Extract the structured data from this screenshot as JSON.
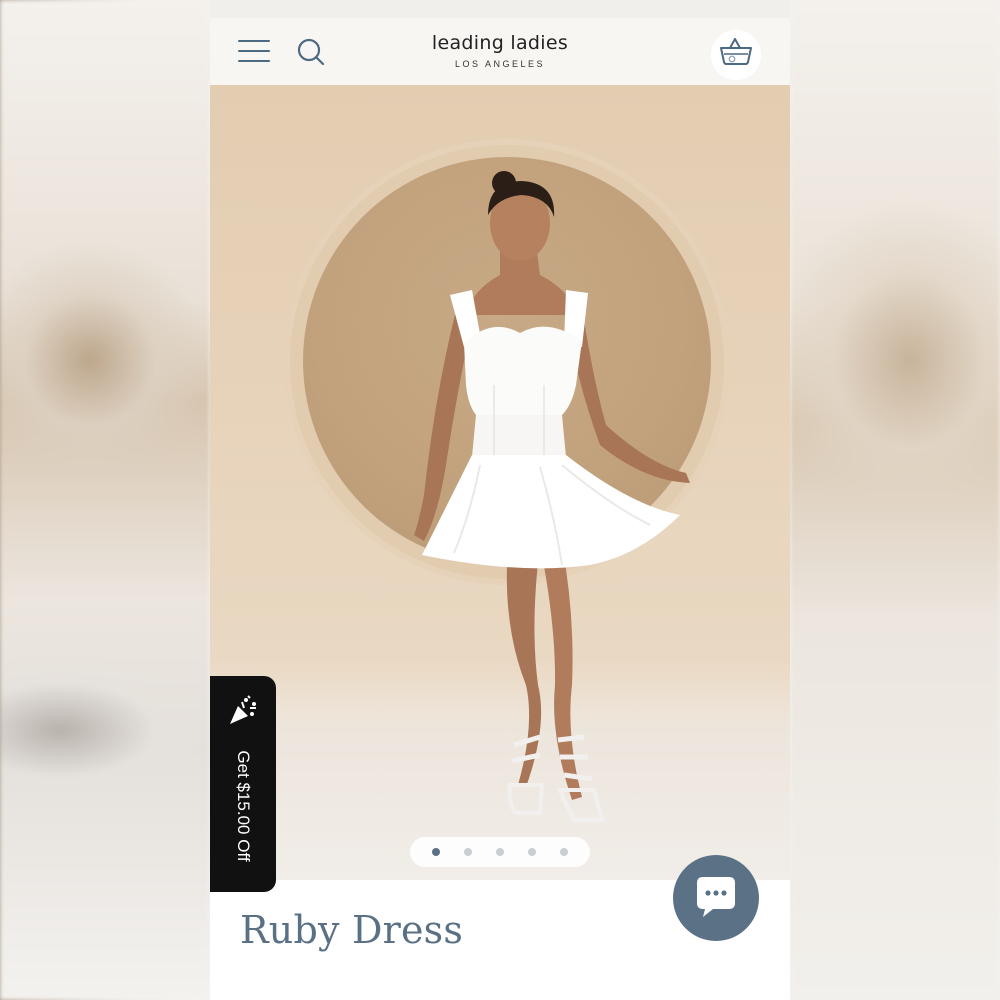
{
  "brand": {
    "name": "leading ladies",
    "subtitle": "LOS ANGELES"
  },
  "header": {
    "menu_icon": "hamburger-menu-icon",
    "search_icon": "search-icon",
    "cart_icon": "shopping-basket-icon"
  },
  "gallery": {
    "image_alt": "Model wearing white Ruby Dress in front of circular arch",
    "slides_total": 5,
    "active_slide": 1
  },
  "promo": {
    "label": "Get $15.00 Off",
    "icon": "party-popper-icon"
  },
  "chat": {
    "icon": "chat-bubble-icon"
  },
  "product": {
    "title": "Ruby Dress"
  },
  "colors": {
    "accent": "#5a7185",
    "header_bg": "#f8f6f2",
    "promo_bg": "#111111",
    "chat_bg": "#5b7186",
    "dress": "#ffffff"
  }
}
